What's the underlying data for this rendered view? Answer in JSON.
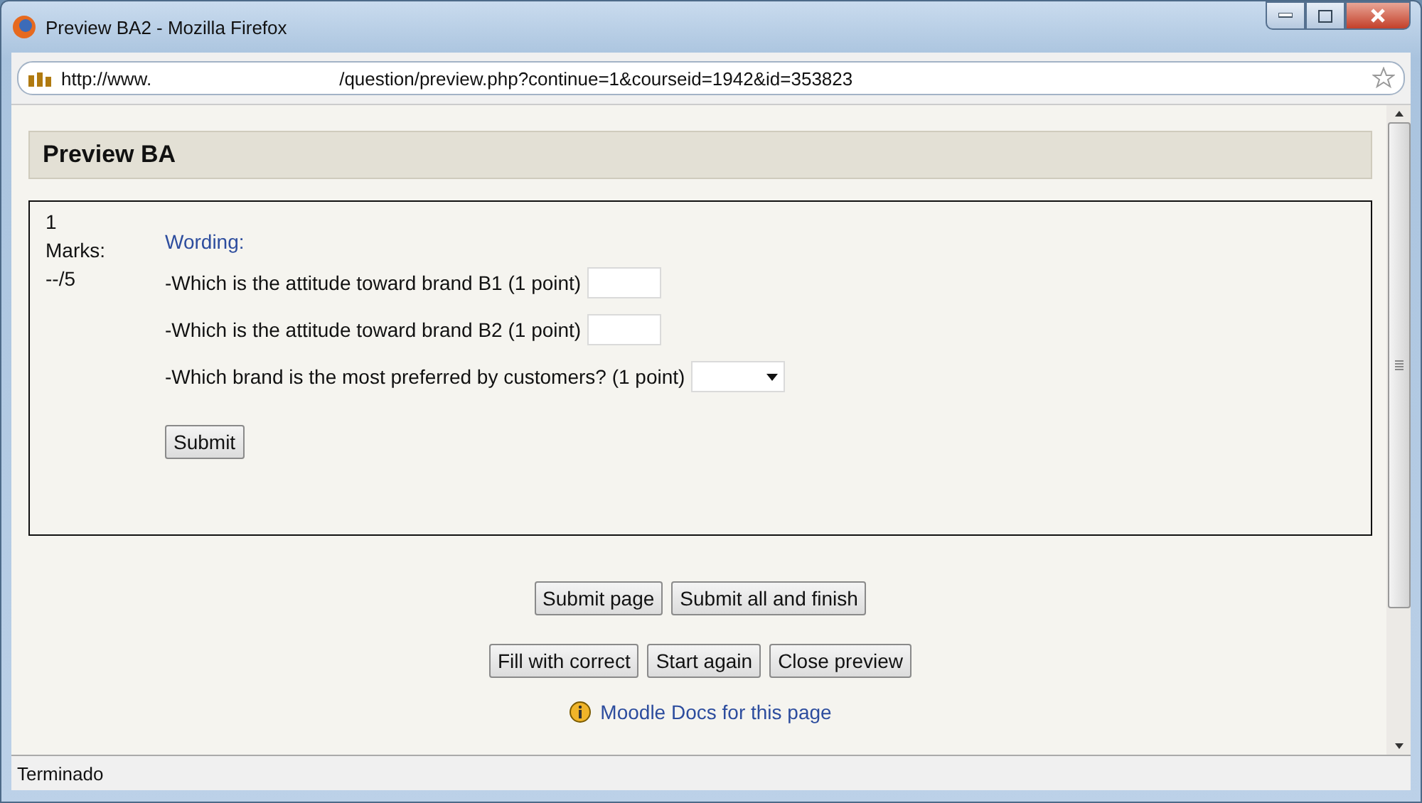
{
  "window": {
    "title": "Preview BA2 - Mozilla Firefox"
  },
  "address_bar": {
    "url_start": "http://www.",
    "url_path": "/question/preview.php?continue=1&courseid=1942&id=353823"
  },
  "page": {
    "heading": "Preview BA",
    "question": {
      "number": "1",
      "marks_label": "Marks:",
      "marks_value": "--/5",
      "wording_label": "Wording:",
      "items": [
        {
          "kind": "text",
          "prompt": "-Which is the attitude toward brand B1 (1 point)"
        },
        {
          "kind": "text",
          "prompt": "-Which is the attitude toward brand B2 (1 point)"
        },
        {
          "kind": "select",
          "prompt": "-Which brand is the most preferred by customers? (1 point)"
        }
      ],
      "submit": "Submit"
    },
    "button_rows": [
      [
        "Submit page",
        "Submit all and finish"
      ],
      [
        "Fill with correct",
        "Start again",
        "Close preview"
      ]
    ],
    "docs_link": "Moodle Docs for this page"
  },
  "status_bar": {
    "text": "Terminado"
  }
}
